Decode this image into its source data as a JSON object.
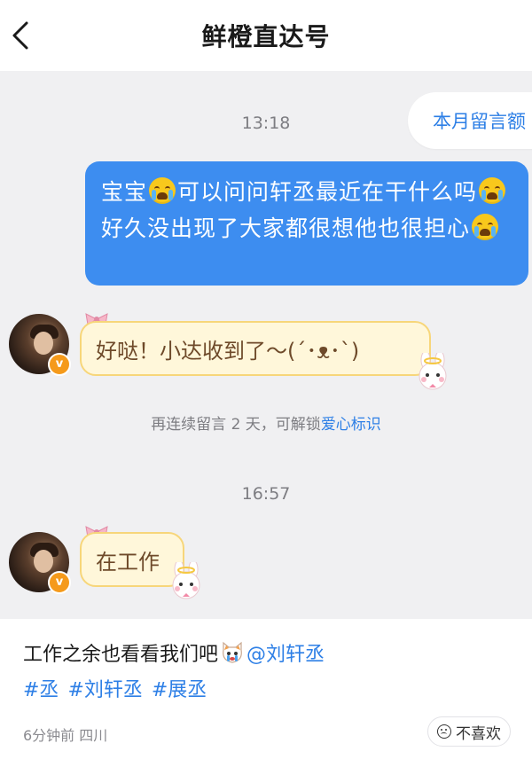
{
  "header": {
    "title": "鲜橙直达号"
  },
  "chat": {
    "pinned_label": "本月留言额",
    "time_1": "13:18",
    "outgoing_message": {
      "part1": "宝宝",
      "part2": "可以问问轩丞最近在干什么吗",
      "part3": "好久没出现了大家都很想他也很担心"
    },
    "reply_1": "好哒！小达收到了～(´･ᴥ･`)",
    "hint": {
      "text": "再连续留言 2 天，可解锁",
      "link": "爱心标识"
    },
    "time_2": "16:57",
    "reply_2": "在工作"
  },
  "post": {
    "text": "工作之余也看看我们吧",
    "mention": "@刘轩丞",
    "tags": [
      "#丞",
      "#刘轩丞",
      "#展丞"
    ],
    "meta": "6分钟前 四川",
    "dislike_label": "不喜欢"
  },
  "icons": {
    "back": "chevron-left-icon",
    "crying_emoji": "crying-face-icon",
    "verified": "verified-badge-icon",
    "bow": "bow-icon",
    "bunny": "bunny-sticker-icon",
    "cat_emoji": "crying-cat-icon",
    "dislike": "smile-icon"
  },
  "colors": {
    "accent_blue": "#3d8df0",
    "link_blue": "#2d7fe6",
    "reply_bg": "#fff7da",
    "reply_border": "#f7d67a",
    "verified_orange": "#f59a1b"
  }
}
